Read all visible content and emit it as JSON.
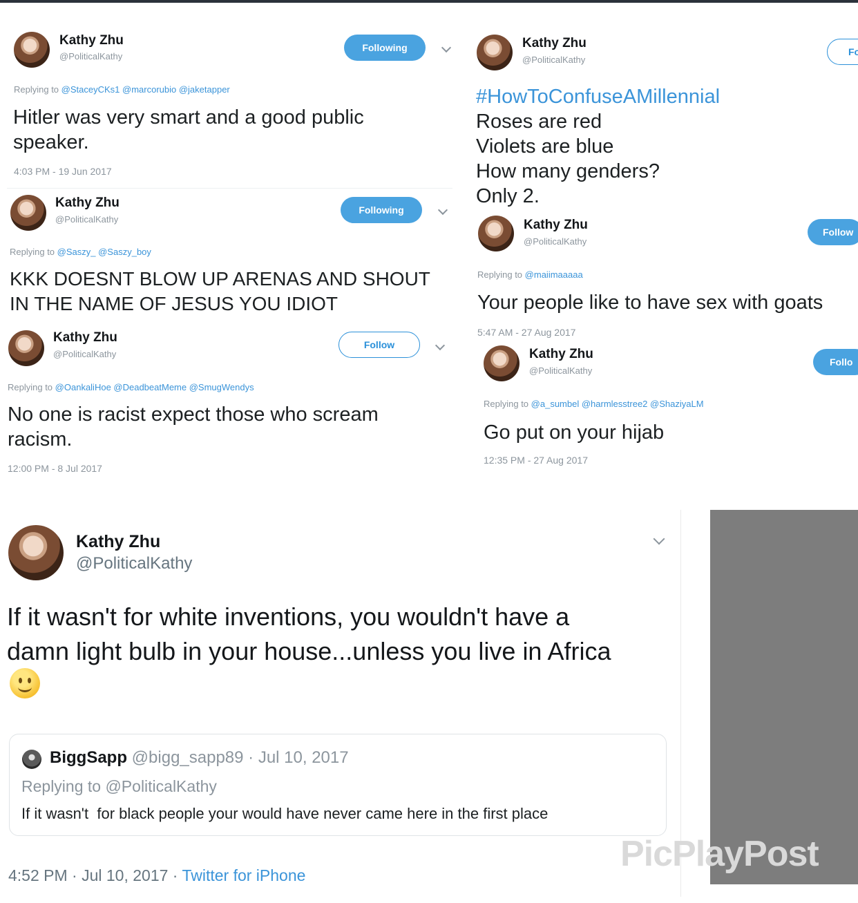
{
  "t1": {
    "name": "Kathy Zhu",
    "handle": "@PoliticalKathy",
    "button": "Following",
    "replying_prefix": "Replying to",
    "replying_mentions": "@StaceyCKs1 @marcorubio @jaketapper",
    "text": "Hitler was very smart and a good public speaker.",
    "time": "4:03 PM - 19 Jun 2017"
  },
  "t2": {
    "name": "Kathy Zhu",
    "handle": "@PoliticalKathy",
    "button": "Following",
    "replying_prefix": "Replying to",
    "replying_mentions": "@Saszy_ @Saszy_boy",
    "text": "KKK DOESNT BLOW UP ARENAS AND SHOUT IN THE NAME OF JESUS YOU IDIOT"
  },
  "t3": {
    "name": "Kathy Zhu",
    "handle": "@PoliticalKathy",
    "button": "Follow",
    "replying_prefix": "Replying to",
    "replying_mentions": "@OankaliHoe @DeadbeatMeme @SmugWendys",
    "text": "No one is racist expect those who scream racism.",
    "time": "12:00 PM - 8 Jul 2017"
  },
  "t4": {
    "name": "Kathy Zhu",
    "handle": "@PoliticalKathy",
    "button": "Follo",
    "hashtag": "#HowToConfuseAMillennial",
    "lines": [
      "Roses are red",
      "Violets are blue",
      "How many genders?",
      "Only 2."
    ]
  },
  "t5": {
    "name": "Kathy Zhu",
    "handle": "@PoliticalKathy",
    "button": "Follow",
    "replying_prefix": "Replying to",
    "replying_mentions": "@maiimaaaaa",
    "text": "Your people like to have sex with goats",
    "time": "5:47 AM - 27 Aug 2017"
  },
  "t6": {
    "name": "Kathy Zhu",
    "handle": "@PoliticalKathy",
    "button": "Follo",
    "replying_prefix": "Replying to",
    "replying_mentions": "@a_sumbel @harmlesstree2 @ShaziyaLM",
    "text": "Go put on your hijab",
    "time": "12:35 PM - 27 Aug 2017"
  },
  "main": {
    "name": "Kathy Zhu",
    "handle": "@PoliticalKathy",
    "text_line1": "If it wasn't for white inventions, you wouldn't have a",
    "text_line2": "damn light bulb in your house...unless you live in Africa",
    "time": "4:52 PM · Jul 10, 2017 · ",
    "source": "Twitter for iPhone"
  },
  "quote": {
    "name": "BiggSapp",
    "meta": "@bigg_sapp89 · Jul 10, 2017",
    "replying": "Replying to @PoliticalKathy",
    "text": "If it wasn't  for black people your would have never came here in the first place"
  },
  "watermark": "PicPlayPost",
  "colors": {
    "link": "#3b94d9",
    "button": "#4aa3e0",
    "muted": "#8c959d"
  }
}
